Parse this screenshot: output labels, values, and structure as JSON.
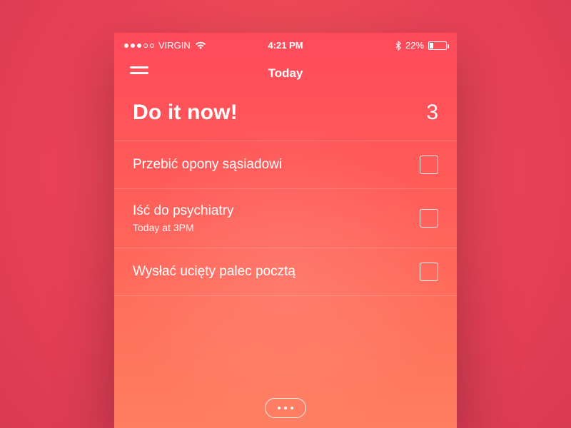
{
  "status": {
    "carrier": "VIRGIN",
    "time": "4:21 PM",
    "battery_pct": "22%"
  },
  "nav": {
    "title": "Today"
  },
  "header": {
    "title": "Do it now!",
    "count": "3"
  },
  "items": [
    {
      "title": "Przebić opony sąsiadowi",
      "sub": ""
    },
    {
      "title": "Iść do psychiatry",
      "sub": "Today at 3PM"
    },
    {
      "title": "Wysłać ucięty palec pocztą",
      "sub": ""
    }
  ]
}
